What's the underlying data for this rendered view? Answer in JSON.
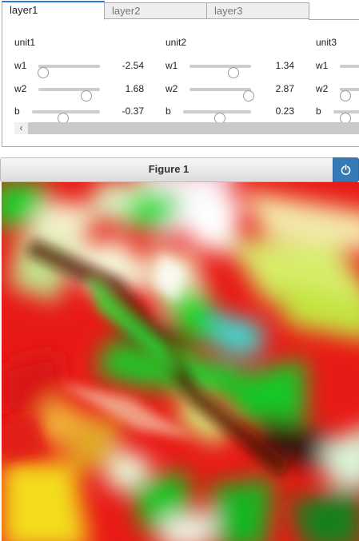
{
  "tabs": [
    {
      "label": "layer1",
      "active": true
    },
    {
      "label": "layer2",
      "active": false
    },
    {
      "label": "layer3",
      "active": false
    }
  ],
  "units": [
    {
      "title": "unit1",
      "params": [
        {
          "label": "w1",
          "value": "-2.54",
          "level": 0.08
        },
        {
          "label": "w2",
          "value": "1.68",
          "level": 0.78
        },
        {
          "label": "b",
          "value": "-0.37",
          "level": 0.46
        }
      ]
    },
    {
      "title": "unit2",
      "params": [
        {
          "label": "w1",
          "value": "1.34",
          "level": 0.72
        },
        {
          "label": "w2",
          "value": "2.87",
          "level": 0.96
        },
        {
          "label": "b",
          "value": "0.23",
          "level": 0.54
        }
      ]
    },
    {
      "title": "unit3",
      "params": [
        {
          "label": "w1",
          "value": "",
          "level": 0.0
        },
        {
          "label": "w2",
          "value": "",
          "level": 0.0
        },
        {
          "label": "b",
          "value": "",
          "level": 0.18
        }
      ]
    }
  ],
  "scroll_left_glyph": "‹",
  "figure": {
    "title": "Figure 1",
    "power_icon": "power-icon",
    "accent": "#337ab7"
  }
}
